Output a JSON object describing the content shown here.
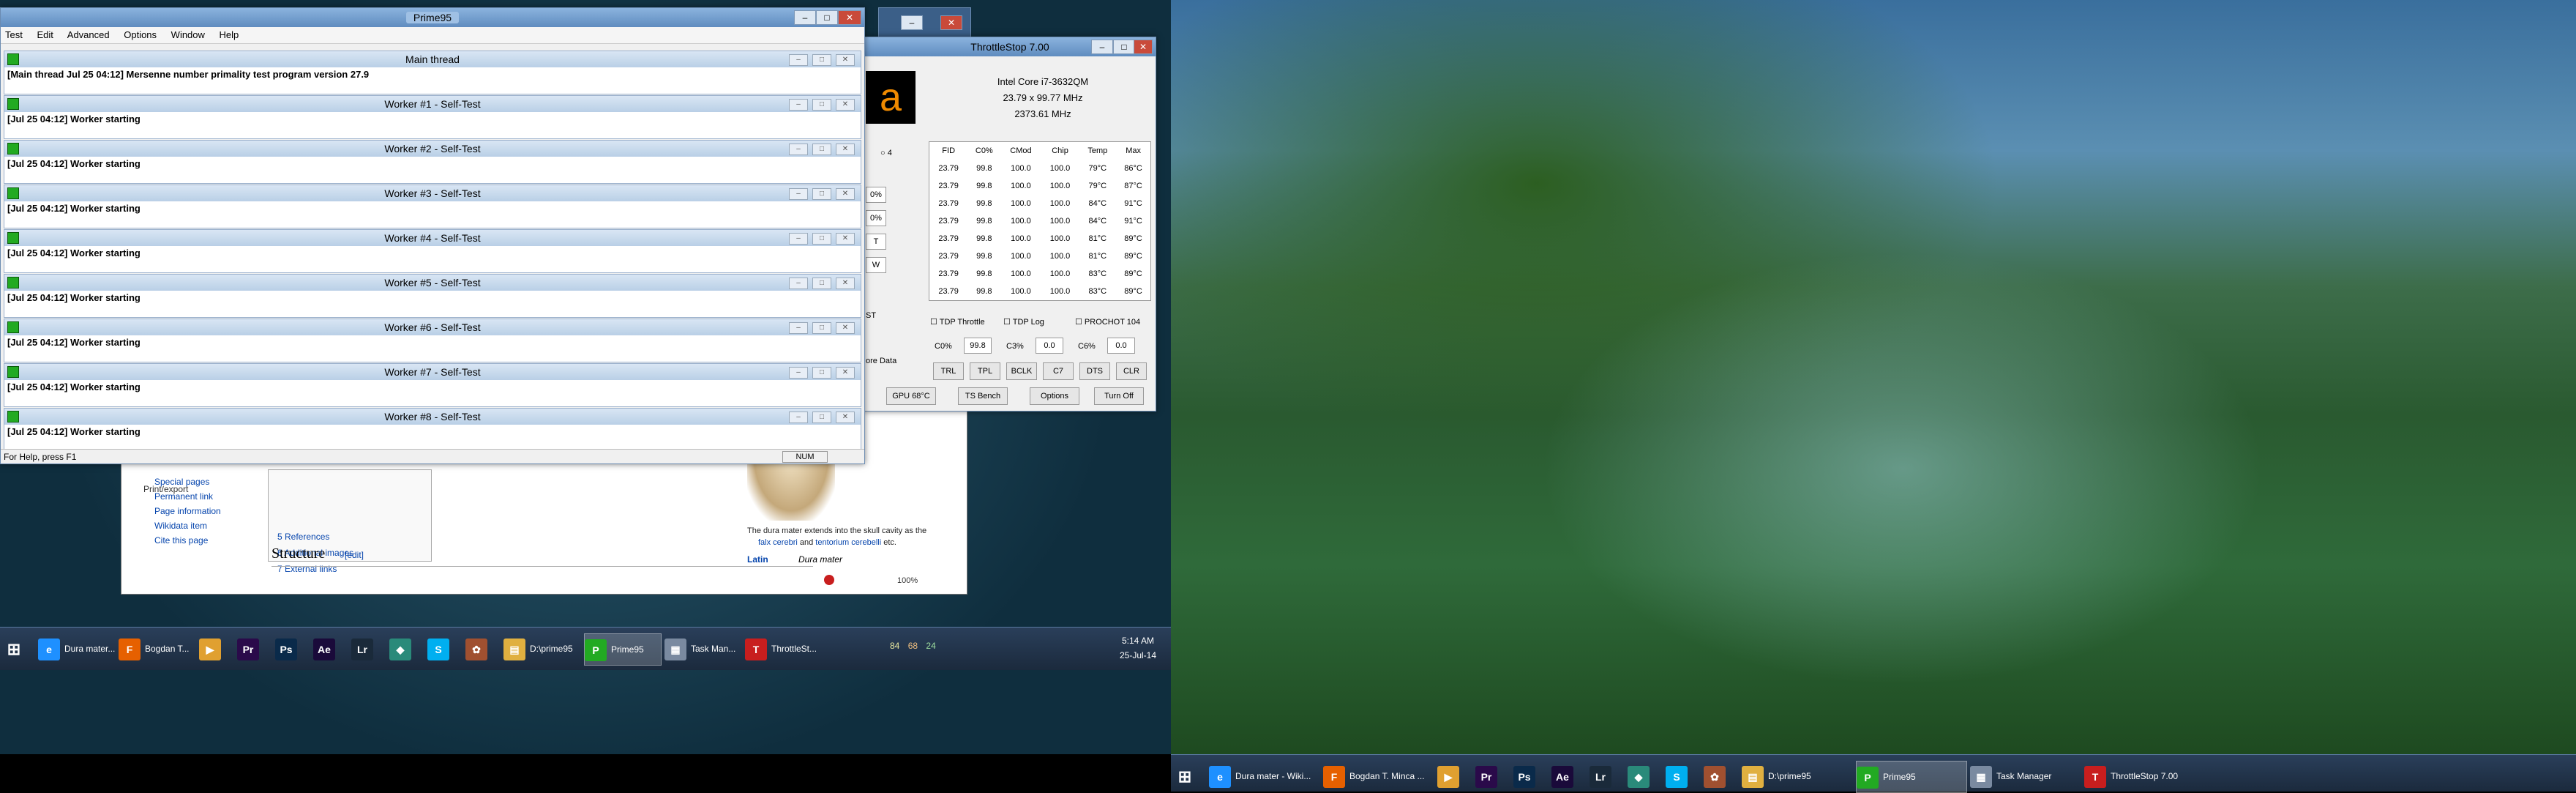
{
  "prime95": {
    "title": "Prime95",
    "menu": [
      "Test",
      "Edit",
      "Advanced",
      "Options",
      "Window",
      "Help"
    ],
    "windows": [
      {
        "title": "Main thread",
        "line": "[Main thread Jul 25 04:12] Mersenne number primality test program version 27.9"
      },
      {
        "title": "Worker #1 - Self-Test",
        "line": "[Jul 25 04:12] Worker starting"
      },
      {
        "title": "Worker #2 - Self-Test",
        "line": "[Jul 25 04:12] Worker starting"
      },
      {
        "title": "Worker #3 - Self-Test",
        "line": "[Jul 25 04:12] Worker starting"
      },
      {
        "title": "Worker #4 - Self-Test",
        "line": "[Jul 25 04:12] Worker starting"
      },
      {
        "title": "Worker #5 - Self-Test",
        "line": "[Jul 25 04:12] Worker starting"
      },
      {
        "title": "Worker #6 - Self-Test",
        "line": "[Jul 25 04:12] Worker starting"
      },
      {
        "title": "Worker #7 - Self-Test",
        "line": "[Jul 25 04:12] Worker starting"
      },
      {
        "title": "Worker #8 - Self-Test",
        "line": "[Jul 25 04:12] Worker starting"
      }
    ],
    "status": "For Help, press F1",
    "num": "NUM"
  },
  "throttlestop": {
    "title": "ThrottleStop 7.00",
    "cpu": "Intel Core i7-3632QM",
    "multiplier": "23.79 x 99.77 MHz",
    "freq": "2373.61 MHz",
    "headers": [
      "FID",
      "C0%",
      "CMod",
      "Chip",
      "Temp",
      "Max"
    ],
    "rows": [
      [
        "23.79",
        "99.8",
        "100.0",
        "100.0",
        "79°C",
        "86°C"
      ],
      [
        "23.79",
        "99.8",
        "100.0",
        "100.0",
        "79°C",
        "87°C"
      ],
      [
        "23.79",
        "99.8",
        "100.0",
        "100.0",
        "84°C",
        "91°C"
      ],
      [
        "23.79",
        "99.8",
        "100.0",
        "100.0",
        "84°C",
        "91°C"
      ],
      [
        "23.79",
        "99.8",
        "100.0",
        "100.0",
        "81°C",
        "89°C"
      ],
      [
        "23.79",
        "99.8",
        "100.0",
        "100.0",
        "81°C",
        "89°C"
      ],
      [
        "23.79",
        "99.8",
        "100.0",
        "100.0",
        "83°C",
        "89°C"
      ],
      [
        "23.79",
        "99.8",
        "100.0",
        "100.0",
        "83°C",
        "89°C"
      ]
    ],
    "checks": {
      "tdp_throttle": "TDP Throttle",
      "tdp_log": "TDP Log",
      "prochot": "PROCHOT 104"
    },
    "c_labels": {
      "c0": "C0%",
      "c0_val": "99.8",
      "c3": "C3%",
      "c3_val": "0.0",
      "c6": "C6%",
      "c6_val": "0.0"
    },
    "buttons": [
      "TRL",
      "TPL",
      "BCLK",
      "C7",
      "DTS",
      "CLR"
    ],
    "bottom_buttons": {
      "gpu": "GPU 68°C",
      "bench": "TS Bench",
      "options": "Options",
      "turnoff": "Turn Off"
    },
    "left_fragments": {
      "opt4": "4",
      "p1": "0%",
      "p2": "0%",
      "p3": "T",
      "p4": "W",
      "st": "ST",
      "data": "ore Data"
    }
  },
  "wiki": {
    "left_links": [
      "Special pages",
      "Permanent link",
      "Page information",
      "Wikidata item",
      "Cite this page"
    ],
    "print": "Print/export",
    "toc": [
      "5 References",
      "6 Additional images",
      "7 External links"
    ],
    "heading": "Structure",
    "edit": "[edit]",
    "caption_1": "The dura mater extends into the skull cavity as the",
    "caption_2a": "falx cerebri",
    "caption_2b": "and",
    "caption_2c": "tentorium cerebelli",
    "caption_2d": "etc.",
    "latin_label": "Latin",
    "latin_value": "Dura mater",
    "zoom": "100%"
  },
  "taskbar_left": {
    "items": [
      {
        "label": "Dura mater...",
        "icon": "ie-icon",
        "glyph": "e",
        "color": "#1e90ff"
      },
      {
        "label": "Bogdan T...",
        "icon": "firefox-icon",
        "glyph": "F",
        "color": "#e66000"
      },
      {
        "label": "",
        "icon": "media-icon",
        "glyph": "▶",
        "color": "#e0a030"
      },
      {
        "label": "",
        "icon": "premiere-icon",
        "glyph": "Pr",
        "color": "#2a0a4a"
      },
      {
        "label": "",
        "icon": "photoshop-icon",
        "glyph": "Ps",
        "color": "#0a2a4a"
      },
      {
        "label": "",
        "icon": "aftereffects-icon",
        "glyph": "Ae",
        "color": "#1a0a3a"
      },
      {
        "label": "",
        "icon": "lightroom-icon",
        "glyph": "Lr",
        "color": "#1a2a3a"
      },
      {
        "label": "",
        "icon": "app-icon",
        "glyph": "◆",
        "color": "#2a8a7a"
      },
      {
        "label": "",
        "icon": "skype-icon",
        "glyph": "S",
        "color": "#00aff0"
      },
      {
        "label": "",
        "icon": "misc-icon",
        "glyph": "✿",
        "color": "#a05030"
      },
      {
        "label": "D:\\prime95",
        "icon": "folder-icon",
        "glyph": "▤",
        "color": "#e0b040"
      },
      {
        "label": "Prime95",
        "icon": "prime95-icon",
        "glyph": "P",
        "color": "#22aa22",
        "active": true
      },
      {
        "label": "Task Man...",
        "icon": "taskmanager-icon",
        "glyph": "▦",
        "color": "#7a8aa0"
      },
      {
        "label": "ThrottleSt...",
        "icon": "throttlestop-icon",
        "glyph": "T",
        "color": "#c81e1e"
      }
    ],
    "tray_temps": [
      "84",
      "68",
      "24"
    ],
    "time": "5:14 AM",
    "date": "25-Jul-14"
  },
  "taskbar_right": {
    "items": [
      {
        "label": "Dura mater - Wiki...",
        "icon": "ie-icon",
        "glyph": "e",
        "color": "#1e90ff"
      },
      {
        "label": "Bogdan T. Minca ...",
        "icon": "firefox-icon",
        "glyph": "F",
        "color": "#e66000"
      },
      {
        "label": "",
        "icon": "media-icon",
        "glyph": "▶",
        "color": "#e0a030"
      },
      {
        "label": "",
        "icon": "premiere-icon",
        "glyph": "Pr",
        "color": "#2a0a4a"
      },
      {
        "label": "",
        "icon": "photoshop-icon",
        "glyph": "Ps",
        "color": "#0a2a4a"
      },
      {
        "label": "",
        "icon": "aftereffects-icon",
        "glyph": "Ae",
        "color": "#1a0a3a"
      },
      {
        "label": "",
        "icon": "lightroom-icon",
        "glyph": "Lr",
        "color": "#1a2a3a"
      },
      {
        "label": "",
        "icon": "app-icon",
        "glyph": "◆",
        "color": "#2a8a7a"
      },
      {
        "label": "",
        "icon": "skype-icon",
        "glyph": "S",
        "color": "#00aff0"
      },
      {
        "label": "",
        "icon": "misc-icon",
        "glyph": "✿",
        "color": "#a05030"
      },
      {
        "label": "D:\\prime95",
        "icon": "folder-icon",
        "glyph": "▤",
        "color": "#e0b040"
      },
      {
        "label": "Prime95",
        "icon": "prime95-icon",
        "glyph": "P",
        "color": "#22aa22",
        "active": true
      },
      {
        "label": "Task Manager",
        "icon": "taskmanager-icon",
        "glyph": "▦",
        "color": "#7a8aa0"
      },
      {
        "label": "ThrottleStop 7.00",
        "icon": "throttlestop-icon",
        "glyph": "T",
        "color": "#c81e1e"
      }
    ]
  }
}
